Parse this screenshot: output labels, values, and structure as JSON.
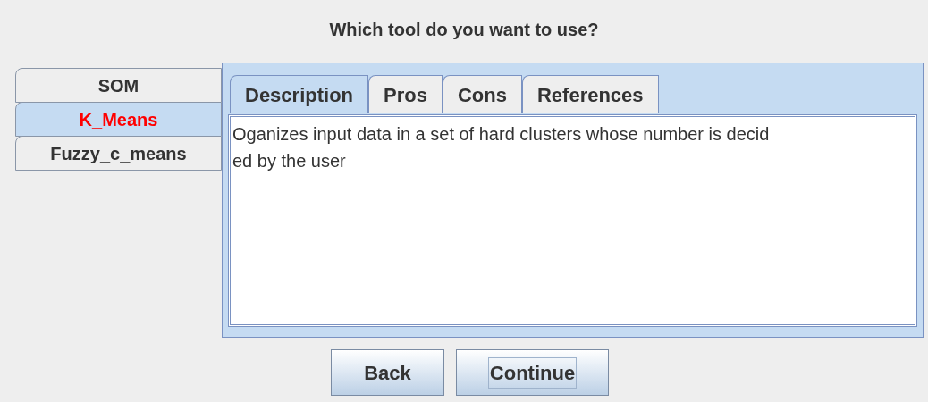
{
  "title": "Which tool do you want to use?",
  "tools": [
    {
      "label": "SOM",
      "selected": false
    },
    {
      "label": "K_Means",
      "selected": true
    },
    {
      "label": "Fuzzy_c_means",
      "selected": false
    }
  ],
  "info_tabs": [
    {
      "label": "Description",
      "selected": true
    },
    {
      "label": "Pros",
      "selected": false
    },
    {
      "label": "Cons",
      "selected": false
    },
    {
      "label": "References",
      "selected": false
    }
  ],
  "description_lines": [
    "Oganizes input data in a set of hard clusters whose number is decid",
    "ed by the user"
  ],
  "buttons": [
    {
      "label": "Back",
      "focused": false
    },
    {
      "label": "Continue",
      "focused": true
    }
  ]
}
